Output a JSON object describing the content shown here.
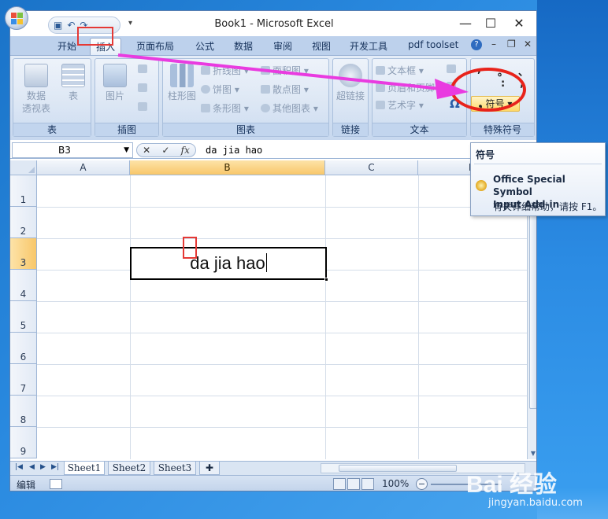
{
  "window": {
    "title": "Book1 - Microsoft Excel",
    "controls": {
      "minimize": "—",
      "maximize": "☐",
      "close": "✕"
    }
  },
  "qat": {
    "save": "▣",
    "undo": "↶",
    "redo": "↷",
    "more": "▾"
  },
  "ribbon_tabs": [
    "开始",
    "插入",
    "页面布局",
    "公式",
    "数据",
    "审阅",
    "视图",
    "开发工具",
    "pdf toolset"
  ],
  "active_tab": "插入",
  "ribbon_ctrls": {
    "help": "?",
    "minimize": "–",
    "restore": "❐",
    "close": "✕"
  },
  "groups": {
    "table": {
      "label": "表",
      "pivot": "数据\n透视表",
      "table": "表"
    },
    "illustrations": {
      "label": "插图",
      "picture": "图片"
    },
    "charts": {
      "label": "图表",
      "column": "柱形图",
      "line": "折线图",
      "pie": "饼图",
      "bar": "条形图",
      "area": "面积图",
      "scatter": "散点图",
      "other": "其他图表"
    },
    "links": {
      "label": "链接",
      "hyperlink": "超链接"
    },
    "text": {
      "label": "文本",
      "textbox": "文本框",
      "header_footer": "页眉和页脚",
      "wordart": "艺术字",
      "omega": "Ω"
    },
    "special": {
      "label": "特殊符号",
      "symbols_row1": [
        ",",
        "。",
        "、"
      ],
      "symbols_row2": [
        ":",
        ";"
      ],
      "button": "符号"
    }
  },
  "formula_bar": {
    "name_box": "B3",
    "buttons": [
      "✕",
      "✓",
      "fx"
    ],
    "content": "da jia hao"
  },
  "grid": {
    "columns": [
      "A",
      "B",
      "C",
      "D"
    ],
    "selected_column": "B",
    "rows": [
      "1",
      "2",
      "3",
      "4",
      "5",
      "6",
      "7",
      "8",
      "9"
    ],
    "selected_row": "3",
    "active_cell_text": "da jia hao"
  },
  "sheets": [
    "Sheet1",
    "Sheet2",
    "Sheet3"
  ],
  "active_sheet": "Sheet1",
  "status": {
    "mode": "编辑",
    "zoom": "100%"
  },
  "tooltip": {
    "title": "符号",
    "line1": "Office Special Symbol",
    "line2": "Input Add-in",
    "help": "有关详细帮助，请按 F1。"
  },
  "watermark": {
    "logo": "Bai 经验",
    "url": "jingyan.baidu.com"
  },
  "colors": {
    "highlight": "#e53935",
    "arrow": "#e93be0",
    "ribbon": "#d4e1f2",
    "selected_header": "#f8c76a"
  }
}
